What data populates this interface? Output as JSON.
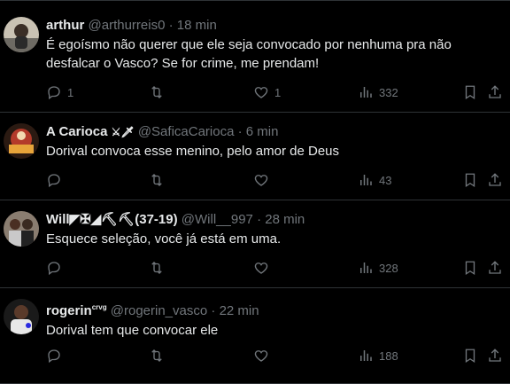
{
  "tweets": [
    {
      "name": "arthur",
      "name_suffix": "",
      "handle": "@arthurreis0",
      "separator": "·",
      "time": "18 min",
      "text": "É egoísmo não querer que ele seja convocado por nenhuma pra não desfalcar o Vasco? Se for crime, me prendam!",
      "replies": "1",
      "retweets": "",
      "likes": "1",
      "views": "332"
    },
    {
      "name": "A Carioca",
      "name_suffix": "⚔🗡",
      "handle": "@SaficaCarioca",
      "separator": "·",
      "time": "6 min",
      "text": "Dorival convoca esse menino, pelo amor de Deus",
      "replies": "",
      "retweets": "",
      "likes": "",
      "views": "43"
    },
    {
      "name": "Will",
      "name_suffix": "◤✠◢⛏⛏(37-19)",
      "handle": "@Will__997",
      "separator": "·",
      "time": "28 min",
      "text": "Esquece seleção, você já está em uma.",
      "replies": "",
      "retweets": "",
      "likes": "",
      "views": "328"
    },
    {
      "name": "rogerin",
      "name_suffix": "crvg",
      "handle": "@rogerin_vasco",
      "separator": "·",
      "time": "22 min",
      "text": "Dorival tem que convocar ele",
      "replies": "",
      "retweets": "",
      "likes": "",
      "views": "188"
    }
  ],
  "colors": {
    "background": "#000000",
    "text": "#e7e9ea",
    "muted": "#71767b",
    "divider": "#2f3336"
  },
  "icons": [
    "reply-icon",
    "retweet-icon",
    "like-icon",
    "views-icon",
    "bookmark-icon",
    "share-icon"
  ]
}
